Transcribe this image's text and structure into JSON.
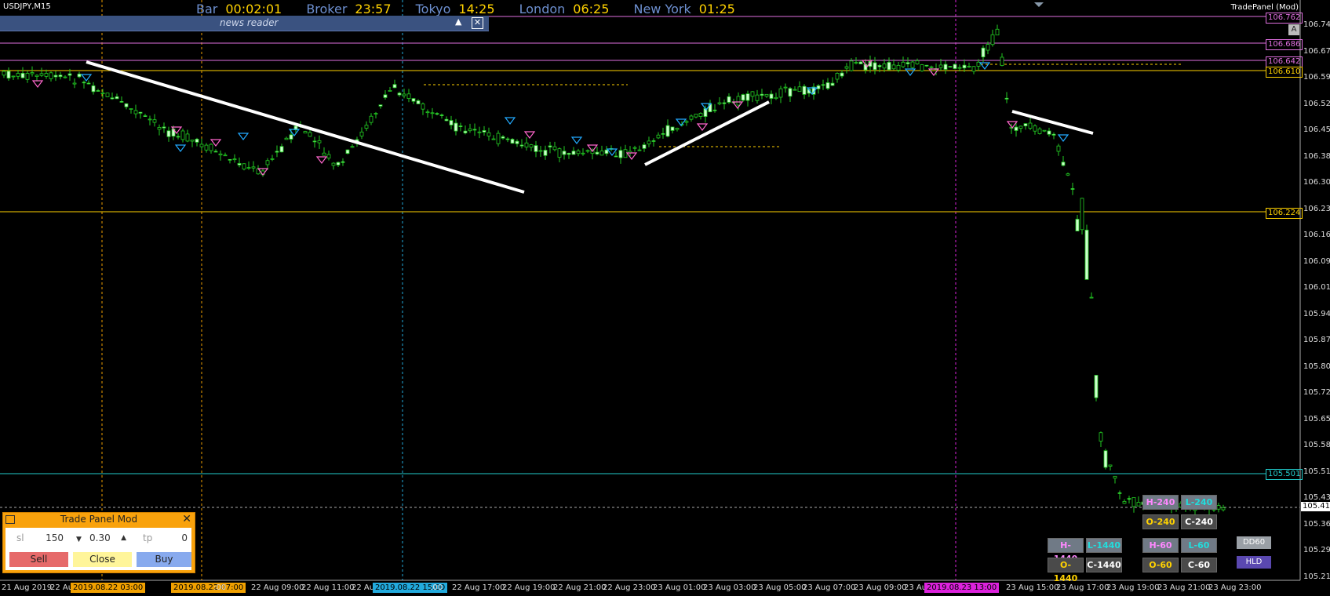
{
  "window": {
    "symbol_title": "USDJPY,M15",
    "tradepanel_title": "TradePanel (Mod)",
    "a_button": "A"
  },
  "timers": [
    {
      "label": "Bar",
      "value": "00:02:01"
    },
    {
      "label": "Broker",
      "value": "23:57"
    },
    {
      "label": "Tokyo",
      "value": "14:25"
    },
    {
      "label": "London",
      "value": "06:25"
    },
    {
      "label": "New York",
      "value": "01:25"
    }
  ],
  "news_reader": {
    "title": "news reader",
    "collapse_symbol": "▲",
    "close_symbol": "✕"
  },
  "colors": {
    "bull": "#ccffcc",
    "bear": "#22cc22",
    "hline_gold": "#ffd200",
    "hline_violet": "#e070e0",
    "hline_cyan": "#22cccc",
    "orange_v": "#f0a000"
  },
  "price_labels": [
    {
      "text": "106.762",
      "color": "#e070e0"
    },
    {
      "text": "106.686",
      "color": "#e070e0"
    },
    {
      "text": "106.642",
      "color": "#e070e0"
    },
    {
      "text": "106.610",
      "color": "#ffd200"
    },
    {
      "text": "106.224",
      "color": "#ffd200"
    },
    {
      "text": "105.501",
      "color": "#22cccc"
    },
    {
      "text": "105.415",
      "color": "#ffffff"
    }
  ],
  "y_axis": [
    "106.740",
    "106.670",
    "106.595",
    "106.525",
    "106.450",
    "106.380",
    "106.305",
    "106.235",
    "106.160",
    "106.090",
    "106.015",
    "105.945",
    "105.870",
    "105.800",
    "105.725",
    "105.655",
    "105.580",
    "105.510",
    "105.435",
    "105.360",
    "105.290",
    "105.215"
  ],
  "x_axis": [
    "21 Aug 2019",
    "22 Au",
    "2019.08.22 03:00",
    "2019.08.22 07:00",
    ":00",
    "22 Aug 09:00",
    "22 Aug 11:00",
    "22 Au",
    "2019.08.22 15:00",
    ":00",
    "22 Aug 17:00",
    "22 Aug 19:00",
    "22 Aug 21:00",
    "22 Aug 23:00",
    "23 Aug 01:00",
    "23 Aug 03:00",
    "23 Aug 05:00",
    "23 Aug 07:00",
    "23 Aug 09:00",
    "23 Au",
    "2019.08.23 13:00",
    "23 Aug 15:00",
    "23 Aug 17:00",
    "23 Aug 19:00",
    "23 Aug 21:00",
    "23 Aug 23:00"
  ],
  "timeframe_buttons": [
    {
      "label": "H-240",
      "bg": "#707a86",
      "fg": "#ff88ff"
    },
    {
      "label": "L-240",
      "bg": "#707a86",
      "fg": "#22dddd"
    },
    {
      "label": "O-240",
      "bg": "#4a4a4a",
      "fg": "#ffd200"
    },
    {
      "label": "C-240",
      "bg": "#4a4a4a",
      "fg": "#ffffff"
    },
    {
      "label": "H-1440",
      "bg": "#707a86",
      "fg": "#ff88ff"
    },
    {
      "label": "L-1440",
      "bg": "#707a86",
      "fg": "#22dddd"
    },
    {
      "label": "H-60",
      "bg": "#707a86",
      "fg": "#ff88ff"
    },
    {
      "label": "L-60",
      "bg": "#707a86",
      "fg": "#22dddd"
    },
    {
      "label": "O-1440",
      "bg": "#4a4a4a",
      "fg": "#ffd200"
    },
    {
      "label": "C-1440",
      "bg": "#4a4a4a",
      "fg": "#ffffff"
    },
    {
      "label": "O-60",
      "bg": "#4a4a4a",
      "fg": "#ffd200"
    },
    {
      "label": "C-60",
      "bg": "#4a4a4a",
      "fg": "#ffffff"
    }
  ],
  "side_buttons": [
    {
      "label": "DD60",
      "bg": "#9aa0a6",
      "fg": "#ffffff"
    },
    {
      "label": "HLD",
      "bg": "#5a48b0",
      "fg": "#ffffff"
    }
  ],
  "trade_panel": {
    "title": "Trade Panel Mod",
    "close_symbol": "✕",
    "sl_label": "sl",
    "sl_value": "150",
    "lot_down": "▼",
    "lot_value": "0.30",
    "lot_up": "▲",
    "tp_label": "tp",
    "tp_value": "0",
    "sell": "Sell",
    "close": "Close",
    "buy": "Buy"
  }
}
